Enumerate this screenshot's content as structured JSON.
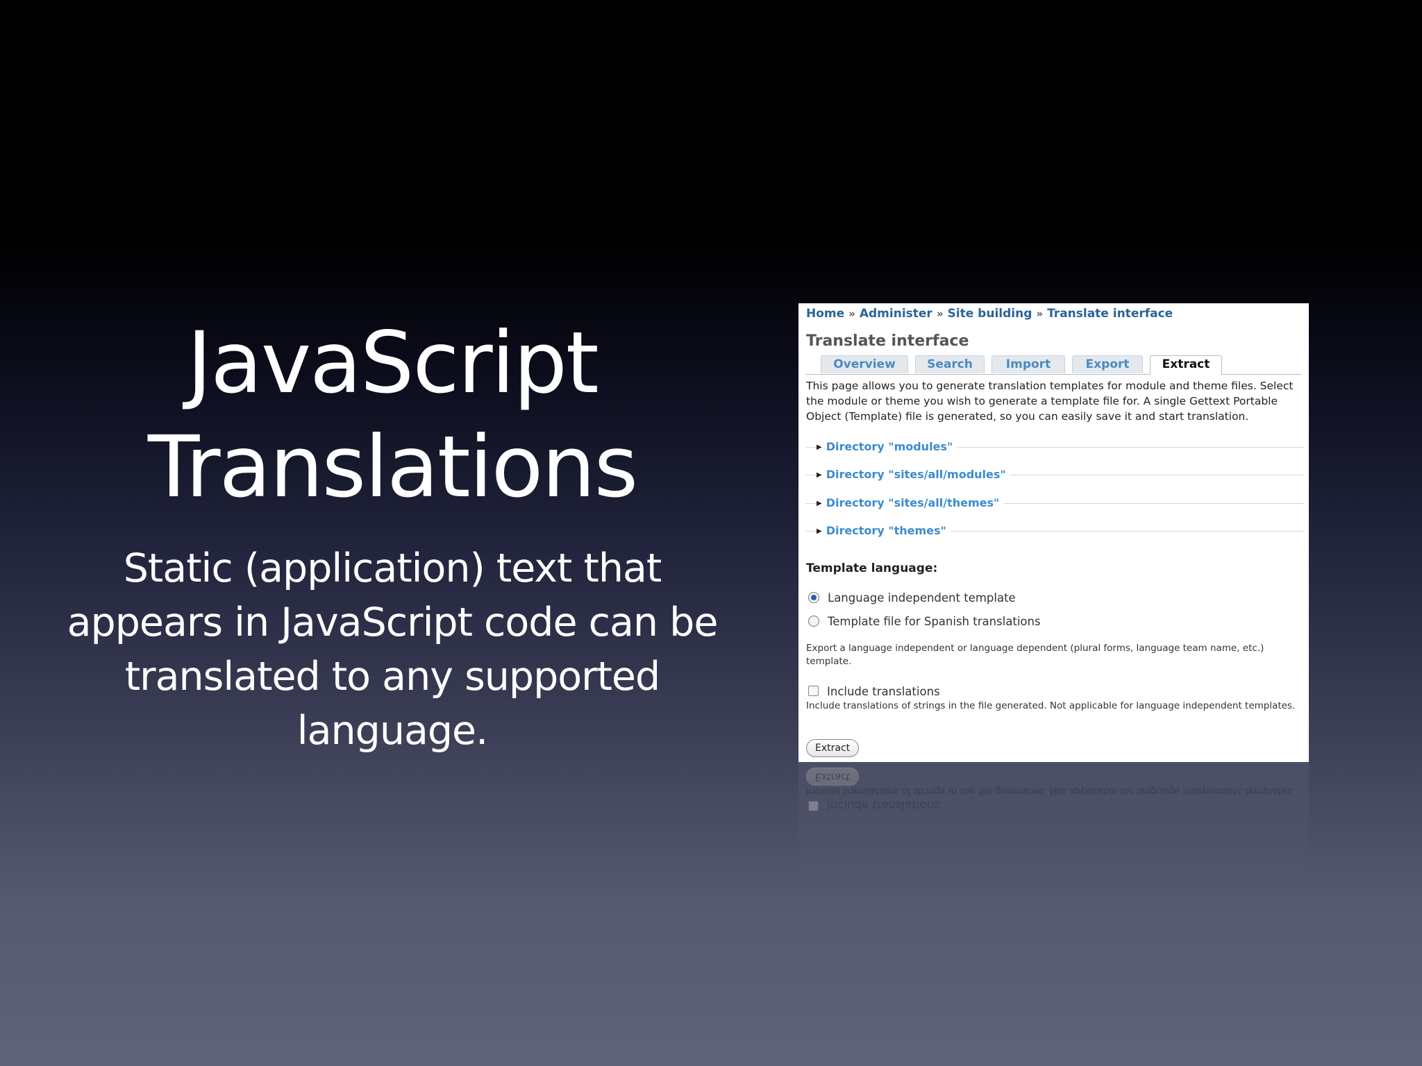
{
  "slide": {
    "title_line1": "JavaScript",
    "title_line2": "Translations",
    "body": "Static (application) text that appears in JavaScript code can be translated to any supported language."
  },
  "screenshot": {
    "breadcrumb": [
      "Home",
      "Administer",
      "Site building",
      "Translate interface"
    ],
    "breadcrumb_separator": "»",
    "heading": "Translate interface",
    "tabs": [
      "Overview",
      "Search",
      "Import",
      "Export",
      "Extract"
    ],
    "active_tab": "Extract",
    "intro": "This page allows you to generate translation templates for module and theme files. Select the module or theme you wish to generate a template file for. A single Gettext Portable Object (Template) file is generated, so you can easily save it and start translation.",
    "directories": [
      "Directory \"modules\"",
      "Directory \"sites/all/modules\"",
      "Directory \"sites/all/themes\"",
      "Directory \"themes\""
    ],
    "template_language_label": "Template language:",
    "radio_options": [
      {
        "label": "Language independent template",
        "checked": true
      },
      {
        "label": "Template file for Spanish translations",
        "checked": false
      }
    ],
    "radio_description": "Export a language independent or language dependent (plural forms, language team name, etc.) template.",
    "checkbox_label": "Include translations",
    "checkbox_checked": false,
    "checkbox_description": "Include translations of strings in the file generated. Not applicable for language independent templates.",
    "submit_label": "Extract"
  },
  "colors": {
    "link": "#2a6496",
    "tab_text": "#4a8ac2",
    "directory_link": "#3b8bd0"
  }
}
